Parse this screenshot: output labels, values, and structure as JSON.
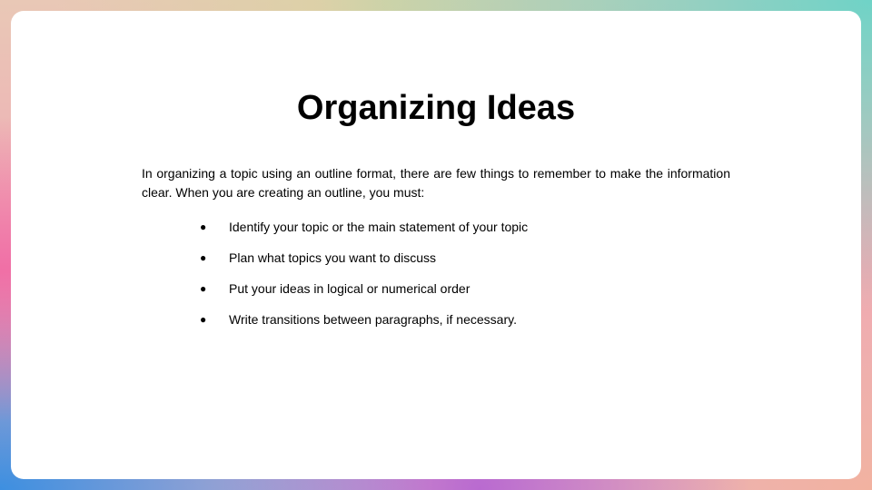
{
  "slide": {
    "title": "Organizing Ideas",
    "intro": "In organizing a topic using an outline format, there are few things to remember to make the information clear. When you are creating an outline, you must:",
    "bullet_glyph": "●",
    "items": [
      "Identify your topic or the main statement of your topic",
      "Plan what topics you want to discuss",
      "Put your ideas in logical or numerical order",
      "Write transitions between paragraphs, if necessary."
    ]
  }
}
